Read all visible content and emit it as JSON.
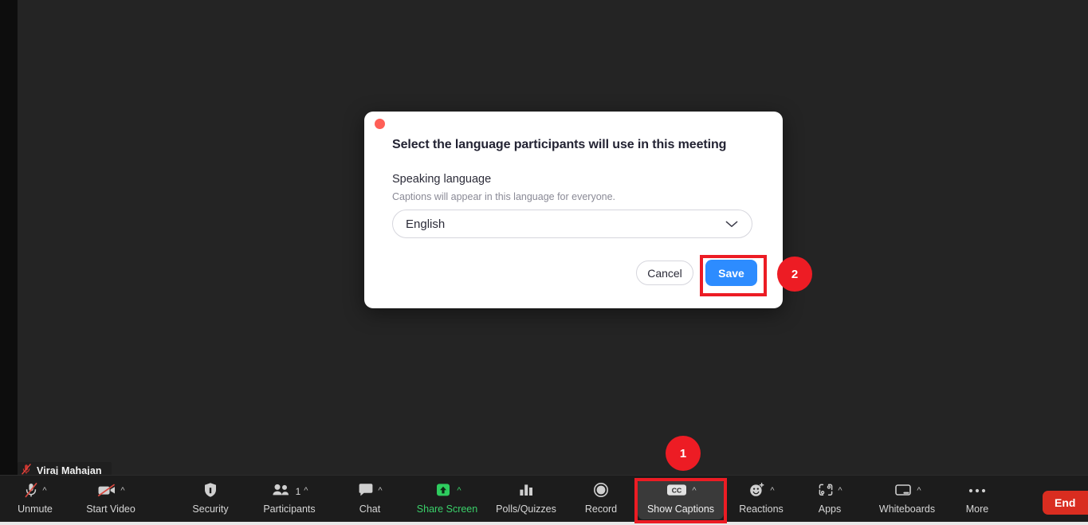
{
  "app": {
    "name": "Zoom Meeting",
    "stage_background": "#242424",
    "toolbar_background": "#1c1c1c"
  },
  "self_view": {
    "participant_name": "Viraj Mahajan",
    "mic_status": "muted",
    "mic_icon": "mic-muted-icon"
  },
  "dialog": {
    "title": "Select the language participants will use in this meeting",
    "field_label": "Speaking language",
    "field_help": "Captions will appear in this language for everyone.",
    "language_select": {
      "value": "English",
      "icon": "chevron-down-icon"
    },
    "cancel_label": "Cancel",
    "save_label": "Save",
    "close_dot": "close-window-dot",
    "accent_color": "#2d8cff"
  },
  "toolbar": {
    "items": [
      {
        "label": "Unmute",
        "icon": "mic-muted-icon",
        "caret": true,
        "count": "",
        "accent": "default"
      },
      {
        "label": "Start Video",
        "icon": "video-off-icon",
        "caret": true,
        "count": "",
        "accent": "default"
      },
      {
        "label": "Security",
        "icon": "shield-icon",
        "caret": false,
        "count": "",
        "accent": "default"
      },
      {
        "label": "Participants",
        "icon": "participants-icon",
        "caret": true,
        "count": "1",
        "accent": "default"
      },
      {
        "label": "Chat",
        "icon": "chat-bubble-icon",
        "caret": true,
        "count": "",
        "accent": "default"
      },
      {
        "label": "Share Screen",
        "icon": "share-screen-icon",
        "caret": true,
        "count": "",
        "accent": "green"
      },
      {
        "label": "Polls/Quizzes",
        "icon": "bar-chart-icon",
        "caret": false,
        "count": "",
        "accent": "default"
      },
      {
        "label": "Record",
        "icon": "record-circle-icon",
        "caret": false,
        "count": "",
        "accent": "default"
      },
      {
        "label": "Show Captions",
        "icon": "closed-caption-icon",
        "caret": true,
        "count": "",
        "accent": "active"
      },
      {
        "label": "Reactions",
        "icon": "reactions-icon",
        "caret": true,
        "count": "",
        "accent": "default"
      },
      {
        "label": "Apps",
        "icon": "apps-icon",
        "caret": true,
        "count": "",
        "accent": "default"
      },
      {
        "label": "Whiteboards",
        "icon": "whiteboard-icon",
        "caret": true,
        "count": "",
        "accent": "default"
      },
      {
        "label": "More",
        "icon": "ellipsis-icon",
        "caret": false,
        "count": "",
        "accent": "default"
      }
    ],
    "end_button": {
      "label": "End",
      "color": "#d92d20"
    }
  },
  "annotations": {
    "highlight_color": "#ed1c24",
    "steps": [
      {
        "number": "1",
        "target": "Show Captions"
      },
      {
        "number": "2",
        "target": "Save"
      }
    ]
  }
}
